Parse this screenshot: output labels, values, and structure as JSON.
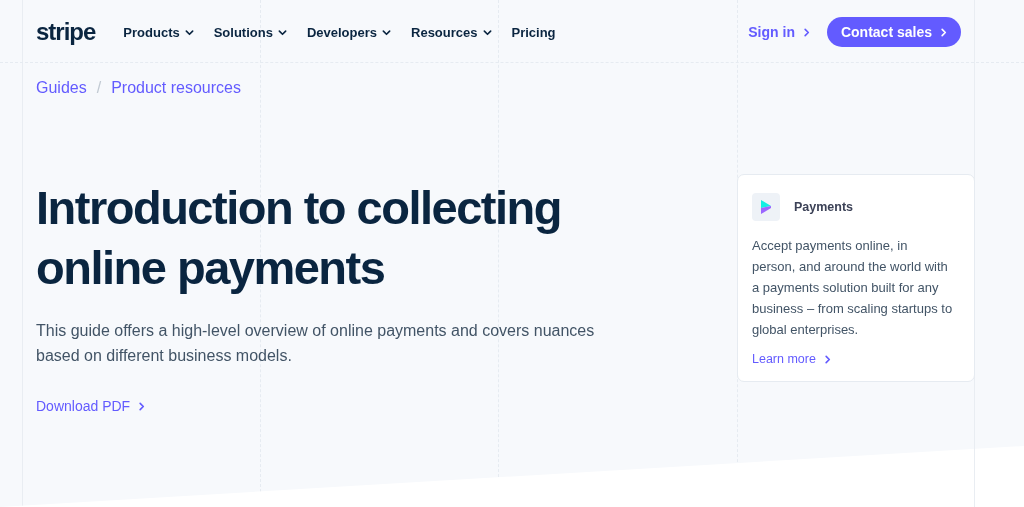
{
  "header": {
    "logo": "stripe",
    "nav": [
      {
        "label": "Products",
        "kind": "menu"
      },
      {
        "label": "Solutions",
        "kind": "menu"
      },
      {
        "label": "Developers",
        "kind": "menu"
      },
      {
        "label": "Resources",
        "kind": "menu"
      },
      {
        "label": "Pricing",
        "kind": "link"
      }
    ],
    "sign_in": "Sign in",
    "contact": "Contact sales"
  },
  "breadcrumb": {
    "separator": "/",
    "items": [
      "Guides",
      "Product resources"
    ]
  },
  "hero": {
    "title": "Introduction to collecting online payments",
    "lead": "This guide offers a high-level overview of online payments and covers nuances based on different business models.",
    "link": "Download PDF"
  },
  "card": {
    "title": "Payments",
    "body": "Accept payments online, in person, and around the world with a payments solution built for any business – from scaling startups to global enterprises.",
    "link": "Learn more"
  }
}
